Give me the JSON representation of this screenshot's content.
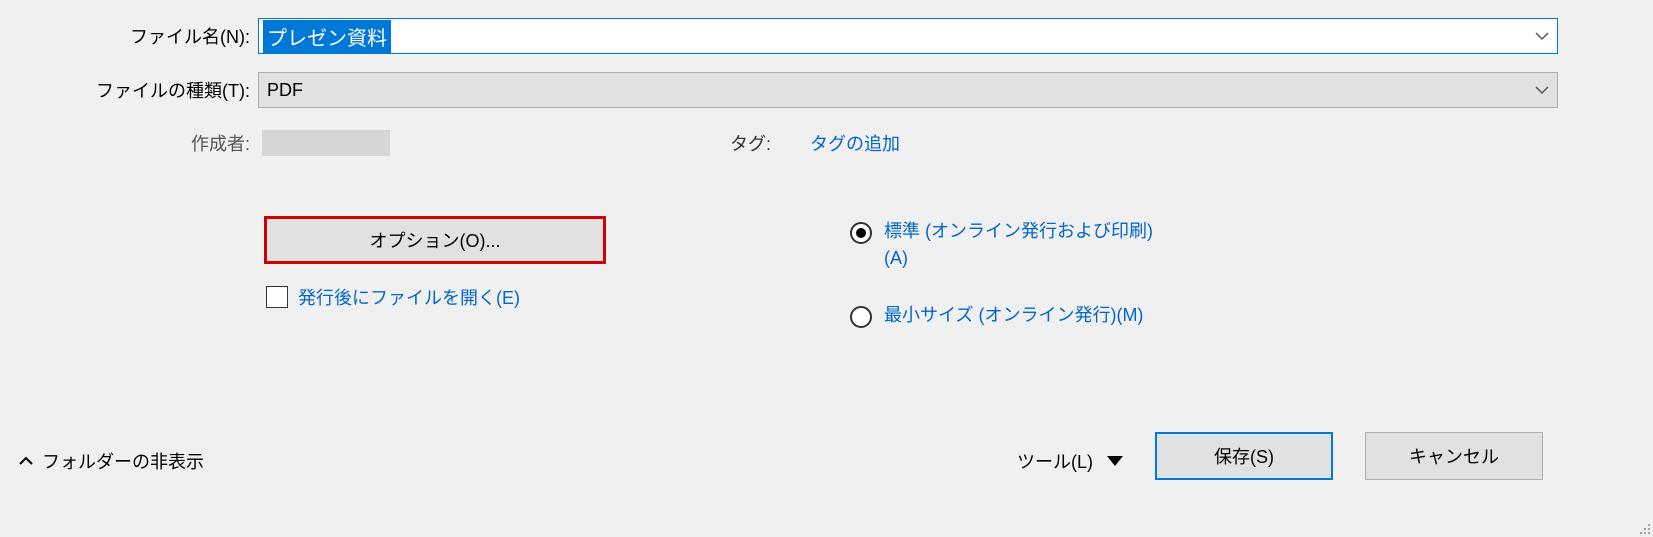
{
  "filename": {
    "label": "ファイル名(N):",
    "value": "プレゼン資料"
  },
  "filetype": {
    "label": "ファイルの種類(T):",
    "value": "PDF"
  },
  "author": {
    "label": "作成者:"
  },
  "tags": {
    "label": "タグ:",
    "add_link": "タグの追加"
  },
  "options_button": "オプション(O)...",
  "open_after_checkbox": "発行後にファイルを開く(E)",
  "optimize": {
    "standard": "標準 (オンライン発行および印刷)(A)",
    "minimum": "最小サイズ (オンライン発行)(M)"
  },
  "hide_folders": "フォルダーの非表示",
  "tools": "ツール(L)",
  "save": "保存(S)",
  "cancel": "キャンセル"
}
